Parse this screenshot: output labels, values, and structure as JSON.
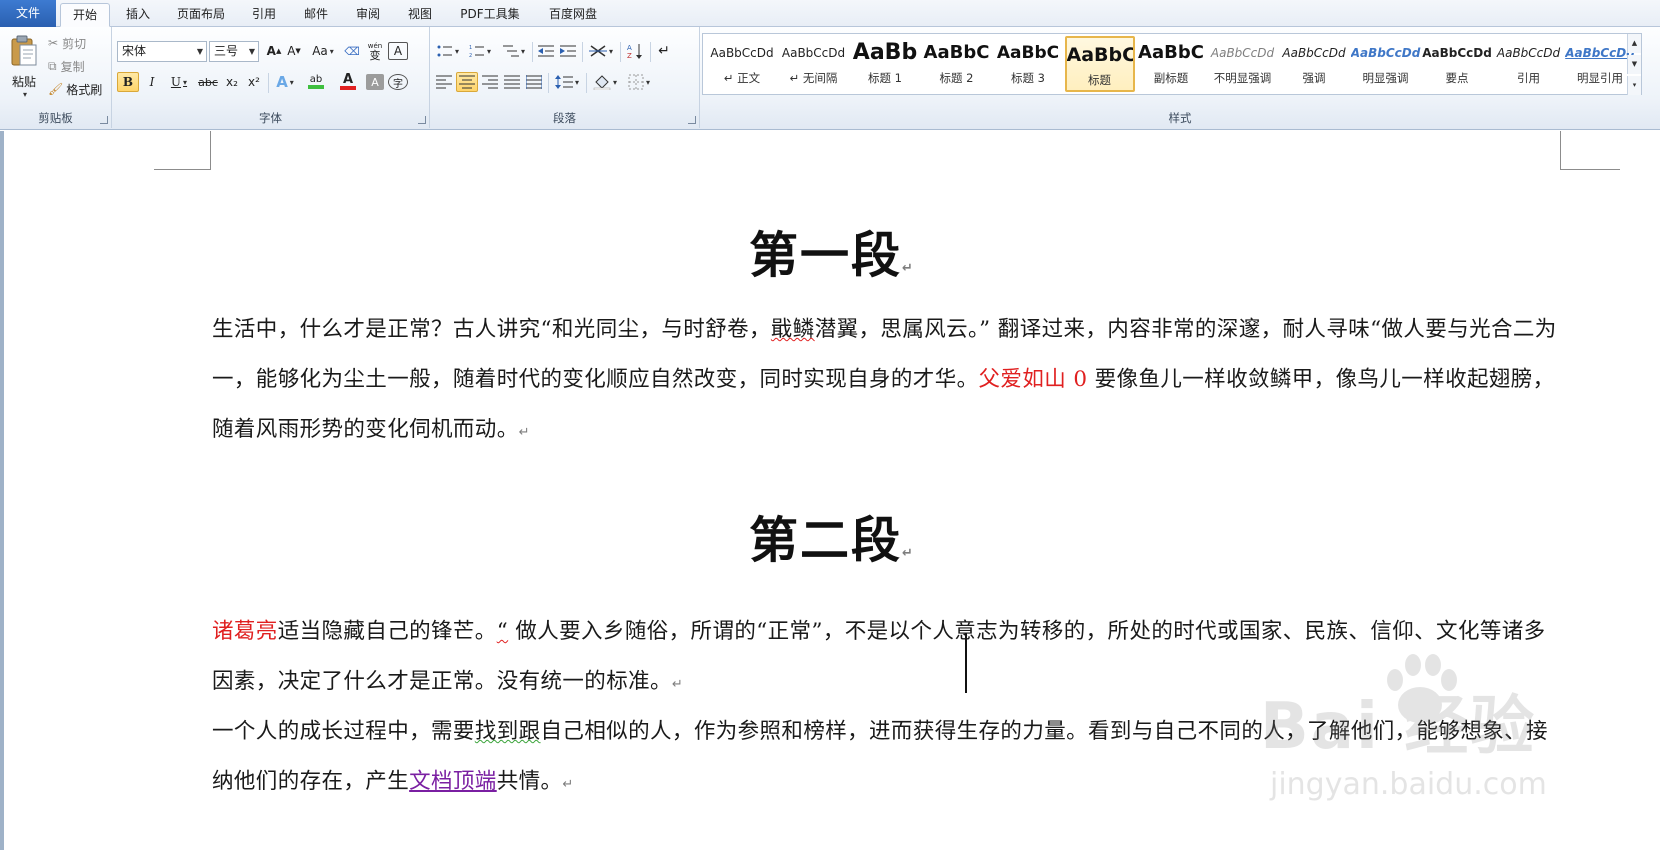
{
  "tabs": {
    "file": "文件",
    "home": "开始",
    "insert": "插入",
    "layout": "页面布局",
    "references": "引用",
    "mailings": "邮件",
    "review": "审阅",
    "view": "视图",
    "pdf": "PDF工具集",
    "baidu": "百度网盘"
  },
  "clipboard": {
    "label": "剪贴板",
    "paste": "粘贴",
    "cut": "剪切",
    "copy": "复制",
    "format_painter": "格式刷"
  },
  "font": {
    "label": "字体",
    "family": "宋体",
    "size": "三号",
    "grow": "A",
    "shrink": "A",
    "case": "Aa",
    "phonetic": "wén",
    "phonetic_char": "变",
    "bordered": "A",
    "bold": "B",
    "italic": "I",
    "underline": "U",
    "strike": "abc",
    "subscript": "x₂",
    "superscript": "x²",
    "effects": "A",
    "highlight": "ab",
    "color": "A",
    "shading": "A",
    "enclosed": "字"
  },
  "paragraph": {
    "label": "段落"
  },
  "styles": {
    "label": "样式",
    "items": [
      {
        "sample": "AaBbCcDd",
        "name": "↵ 正文"
      },
      {
        "sample": "AaBbCcDd",
        "name": "↵ 无间隔"
      },
      {
        "sample": "AaBb",
        "name": "标题 1"
      },
      {
        "sample": "AaBbC",
        "name": "标题 2"
      },
      {
        "sample": "AaBbC",
        "name": "标题 3"
      },
      {
        "sample": "AaBbC",
        "name": "标题"
      },
      {
        "sample": "AaBbC",
        "name": "副标题"
      },
      {
        "sample": "AaBbCcDd",
        "name": "不明显强调"
      },
      {
        "sample": "AaBbCcDd",
        "name": "强调"
      },
      {
        "sample": "AaBbCcDd",
        "name": "明显强调"
      },
      {
        "sample": "AaBbCcDd",
        "name": "要点"
      },
      {
        "sample": "AaBbCcDd",
        "name": "引用"
      },
      {
        "sample": "AaBbCcDd",
        "name": "明显引用"
      }
    ],
    "selected_index": 5
  },
  "document": {
    "heading1": "第一段",
    "heading2": "第二段",
    "p1_a": "生活中，什么才是正常？古人讲究“和光同尘，与时舒卷，",
    "p1_squig": "戢鳞",
    "p1_b": "潜翼，思属风云。” 翻译过来，内容非常的深邃，耐人寻味“做人要与光合二为一，能够化为尘土一般，随着时代的变化顺应自然改变，同时实现自身的才华。",
    "p1_red": "父爱如山 0",
    "p1_c": " 要像鱼儿一样收敛鳞甲，像鸟儿一样收起翅膀，随着风雨形势的变化伺机而动。",
    "p2_red": "诸葛亮",
    "p2_a": "适当隐藏自己的锋芒。",
    "p2_squig": "“",
    "p2_b": " 做人要入乡随俗，所谓的“正常”，不是以个人意志为转移的，所处的时代或国家、民族、信仰、文化等诸多因素，决定了什么才是正常。没有统一的标准。",
    "p3_a": "一个人的成长过程中，需要",
    "p3_squig": "找到跟",
    "p3_b": "自己相似的人，作为参照和榜样，进而获得生存的力量。看到与自己不同的人，了解他们，能够想象、接纳他们的存在，产生",
    "p3_link": "文档顶端",
    "p3_c": "共情。",
    "para_mark": "↵"
  },
  "watermark": {
    "logo": "Bai 经验",
    "url": "jingyan.baidu.com"
  },
  "colors": {
    "accent_red": "#e02020",
    "link_purple": "#7a1fa2",
    "file_tab": "#2a5fb0"
  }
}
